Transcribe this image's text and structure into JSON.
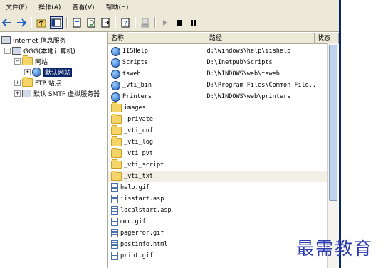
{
  "menu": [
    "文件(F)",
    "操作(A)",
    "查看(V)",
    "帮助(H)"
  ],
  "tree": {
    "root": "Internet 信息服务",
    "computer": "GGG(本地计算机)",
    "sites_folder": "网站",
    "default_site": "默认网站",
    "ftp": "FTP 站点",
    "smtp": "默认 SMTP 虚拟服务器"
  },
  "list": {
    "columns": [
      "名称",
      "路径",
      "状态"
    ],
    "rows": [
      {
        "name": "IISHelp",
        "path": "d:\\windows\\help\\iishelp",
        "icon": "globe-icon"
      },
      {
        "name": "Scripts",
        "path": "D:\\Inetpub\\Scripts",
        "icon": "globe-icon"
      },
      {
        "name": "tsweb",
        "path": "D:\\WINDOWS\\web\\tsweb",
        "icon": "globe-icon"
      },
      {
        "name": "_vti_bin",
        "path": "D:\\Program Files\\Common File...",
        "icon": "globe-icon"
      },
      {
        "name": "Printers",
        "path": "D:\\WINDOWS\\web\\printers",
        "icon": "globe-icon"
      },
      {
        "name": "images",
        "path": "",
        "icon": "folder-icon"
      },
      {
        "name": "_private",
        "path": "",
        "icon": "folder-icon"
      },
      {
        "name": "_vti_cnf",
        "path": "",
        "icon": "folder-icon"
      },
      {
        "name": "_vti_log",
        "path": "",
        "icon": "folder-icon"
      },
      {
        "name": "_vti_pvt",
        "path": "",
        "icon": "folder-icon"
      },
      {
        "name": "_vti_script",
        "path": "",
        "icon": "folder-icon"
      },
      {
        "name": "_vti_txt",
        "path": "",
        "icon": "folder-icon"
      },
      {
        "name": "help.gif",
        "path": "",
        "icon": "file-icon"
      },
      {
        "name": "iisstart.asp",
        "path": "",
        "icon": "file-icon"
      },
      {
        "name": "localstart.asp",
        "path": "",
        "icon": "file-icon"
      },
      {
        "name": "mmc.gif",
        "path": "",
        "icon": "file-icon"
      },
      {
        "name": "pagerror.gif",
        "path": "",
        "icon": "file-icon"
      },
      {
        "name": "postinfo.html",
        "path": "",
        "icon": "file-icon"
      },
      {
        "name": "print.gif",
        "path": "",
        "icon": "file-icon"
      }
    ]
  },
  "watermark": "最需教育",
  "colors": {
    "selection": "#0a246a",
    "chrome": "#ece9d8",
    "folder": "#f5d468"
  }
}
